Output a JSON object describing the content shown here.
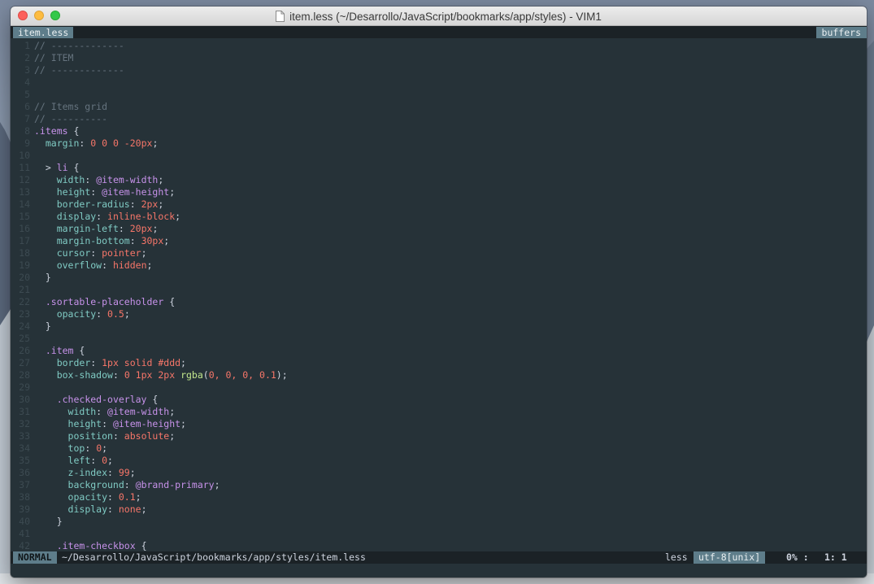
{
  "window": {
    "title": "item.less (~/Desarrollo/JavaScript/bookmarks/app/styles) - VIM1"
  },
  "tabline": {
    "active_tab": "item.less",
    "buffers_label": "buffers"
  },
  "editor": {
    "lines": [
      {
        "n": "1",
        "tokens": [
          {
            "t": "// -------------",
            "c": "com"
          }
        ]
      },
      {
        "n": "2",
        "tokens": [
          {
            "t": "// ITEM",
            "c": "com"
          }
        ]
      },
      {
        "n": "3",
        "tokens": [
          {
            "t": "// -------------",
            "c": "com"
          }
        ]
      },
      {
        "n": "4",
        "tokens": []
      },
      {
        "n": "5",
        "tokens": []
      },
      {
        "n": "6",
        "tokens": [
          {
            "t": "// Items grid",
            "c": "com"
          }
        ]
      },
      {
        "n": "7",
        "tokens": [
          {
            "t": "// ----------",
            "c": "com"
          }
        ]
      },
      {
        "n": "8",
        "tokens": [
          {
            "t": ".items",
            "c": "sel"
          },
          {
            "t": " {",
            "c": "pun"
          }
        ]
      },
      {
        "n": "9",
        "tokens": [
          {
            "t": "  ",
            "c": "pun"
          },
          {
            "t": "margin",
            "c": "prop"
          },
          {
            "t": ": ",
            "c": "pun"
          },
          {
            "t": "0 0 0 -20px",
            "c": "num"
          },
          {
            "t": ";",
            "c": "pun"
          }
        ]
      },
      {
        "n": "10",
        "tokens": []
      },
      {
        "n": "11",
        "tokens": [
          {
            "t": "  > ",
            "c": "pun"
          },
          {
            "t": "li",
            "c": "sel"
          },
          {
            "t": " {",
            "c": "pun"
          }
        ]
      },
      {
        "n": "12",
        "tokens": [
          {
            "t": "    ",
            "c": "pun"
          },
          {
            "t": "width",
            "c": "prop"
          },
          {
            "t": ": ",
            "c": "pun"
          },
          {
            "t": "@item-width",
            "c": "var"
          },
          {
            "t": ";",
            "c": "pun"
          }
        ]
      },
      {
        "n": "13",
        "tokens": [
          {
            "t": "    ",
            "c": "pun"
          },
          {
            "t": "height",
            "c": "prop"
          },
          {
            "t": ": ",
            "c": "pun"
          },
          {
            "t": "@item-height",
            "c": "var"
          },
          {
            "t": ";",
            "c": "pun"
          }
        ]
      },
      {
        "n": "14",
        "tokens": [
          {
            "t": "    ",
            "c": "pun"
          },
          {
            "t": "border-radius",
            "c": "prop"
          },
          {
            "t": ": ",
            "c": "pun"
          },
          {
            "t": "2px",
            "c": "num"
          },
          {
            "t": ";",
            "c": "pun"
          }
        ]
      },
      {
        "n": "15",
        "tokens": [
          {
            "t": "    ",
            "c": "pun"
          },
          {
            "t": "display",
            "c": "prop"
          },
          {
            "t": ": ",
            "c": "pun"
          },
          {
            "t": "inline-block",
            "c": "num"
          },
          {
            "t": ";",
            "c": "pun"
          }
        ]
      },
      {
        "n": "16",
        "tokens": [
          {
            "t": "    ",
            "c": "pun"
          },
          {
            "t": "margin-left",
            "c": "prop"
          },
          {
            "t": ": ",
            "c": "pun"
          },
          {
            "t": "20px",
            "c": "num"
          },
          {
            "t": ";",
            "c": "pun"
          }
        ]
      },
      {
        "n": "17",
        "tokens": [
          {
            "t": "    ",
            "c": "pun"
          },
          {
            "t": "margin-bottom",
            "c": "prop"
          },
          {
            "t": ": ",
            "c": "pun"
          },
          {
            "t": "30px",
            "c": "num"
          },
          {
            "t": ";",
            "c": "pun"
          }
        ]
      },
      {
        "n": "18",
        "tokens": [
          {
            "t": "    ",
            "c": "pun"
          },
          {
            "t": "cursor",
            "c": "prop"
          },
          {
            "t": ": ",
            "c": "pun"
          },
          {
            "t": "pointer",
            "c": "num"
          },
          {
            "t": ";",
            "c": "pun"
          }
        ]
      },
      {
        "n": "19",
        "tokens": [
          {
            "t": "    ",
            "c": "pun"
          },
          {
            "t": "overflow",
            "c": "prop"
          },
          {
            "t": ": ",
            "c": "pun"
          },
          {
            "t": "hidden",
            "c": "num"
          },
          {
            "t": ";",
            "c": "pun"
          }
        ]
      },
      {
        "n": "20",
        "tokens": [
          {
            "t": "  }",
            "c": "pun"
          }
        ]
      },
      {
        "n": "21",
        "tokens": []
      },
      {
        "n": "22",
        "tokens": [
          {
            "t": "  ",
            "c": "pun"
          },
          {
            "t": ".sortable-placeholder",
            "c": "sel"
          },
          {
            "t": " {",
            "c": "pun"
          }
        ]
      },
      {
        "n": "23",
        "tokens": [
          {
            "t": "    ",
            "c": "pun"
          },
          {
            "t": "opacity",
            "c": "prop"
          },
          {
            "t": ": ",
            "c": "pun"
          },
          {
            "t": "0.5",
            "c": "num"
          },
          {
            "t": ";",
            "c": "pun"
          }
        ]
      },
      {
        "n": "24",
        "tokens": [
          {
            "t": "  }",
            "c": "pun"
          }
        ]
      },
      {
        "n": "25",
        "tokens": []
      },
      {
        "n": "26",
        "tokens": [
          {
            "t": "  ",
            "c": "pun"
          },
          {
            "t": ".item",
            "c": "sel"
          },
          {
            "t": " {",
            "c": "pun"
          }
        ]
      },
      {
        "n": "27",
        "tokens": [
          {
            "t": "    ",
            "c": "pun"
          },
          {
            "t": "border",
            "c": "prop"
          },
          {
            "t": ": ",
            "c": "pun"
          },
          {
            "t": "1px solid #ddd",
            "c": "num"
          },
          {
            "t": ";",
            "c": "pun"
          }
        ]
      },
      {
        "n": "28",
        "tokens": [
          {
            "t": "    ",
            "c": "pun"
          },
          {
            "t": "box-shadow",
            "c": "prop"
          },
          {
            "t": ": ",
            "c": "pun"
          },
          {
            "t": "0 1px 2px ",
            "c": "num"
          },
          {
            "t": "rgba",
            "c": "fn"
          },
          {
            "t": "(",
            "c": "pun"
          },
          {
            "t": "0, 0, 0, 0.1",
            "c": "num"
          },
          {
            "t": ");",
            "c": "pun"
          }
        ]
      },
      {
        "n": "29",
        "tokens": []
      },
      {
        "n": "30",
        "tokens": [
          {
            "t": "    ",
            "c": "pun"
          },
          {
            "t": ".checked-overlay",
            "c": "sel"
          },
          {
            "t": " {",
            "c": "pun"
          }
        ]
      },
      {
        "n": "31",
        "tokens": [
          {
            "t": "      ",
            "c": "pun"
          },
          {
            "t": "width",
            "c": "prop"
          },
          {
            "t": ": ",
            "c": "pun"
          },
          {
            "t": "@item-width",
            "c": "var"
          },
          {
            "t": ";",
            "c": "pun"
          }
        ]
      },
      {
        "n": "32",
        "tokens": [
          {
            "t": "      ",
            "c": "pun"
          },
          {
            "t": "height",
            "c": "prop"
          },
          {
            "t": ": ",
            "c": "pun"
          },
          {
            "t": "@item-height",
            "c": "var"
          },
          {
            "t": ";",
            "c": "pun"
          }
        ]
      },
      {
        "n": "33",
        "tokens": [
          {
            "t": "      ",
            "c": "pun"
          },
          {
            "t": "position",
            "c": "prop"
          },
          {
            "t": ": ",
            "c": "pun"
          },
          {
            "t": "absolute",
            "c": "num"
          },
          {
            "t": ";",
            "c": "pun"
          }
        ]
      },
      {
        "n": "34",
        "tokens": [
          {
            "t": "      ",
            "c": "pun"
          },
          {
            "t": "top",
            "c": "prop"
          },
          {
            "t": ": ",
            "c": "pun"
          },
          {
            "t": "0",
            "c": "num"
          },
          {
            "t": ";",
            "c": "pun"
          }
        ]
      },
      {
        "n": "35",
        "tokens": [
          {
            "t": "      ",
            "c": "pun"
          },
          {
            "t": "left",
            "c": "prop"
          },
          {
            "t": ": ",
            "c": "pun"
          },
          {
            "t": "0",
            "c": "num"
          },
          {
            "t": ";",
            "c": "pun"
          }
        ]
      },
      {
        "n": "36",
        "tokens": [
          {
            "t": "      ",
            "c": "pun"
          },
          {
            "t": "z-index",
            "c": "prop"
          },
          {
            "t": ": ",
            "c": "pun"
          },
          {
            "t": "99",
            "c": "num"
          },
          {
            "t": ";",
            "c": "pun"
          }
        ]
      },
      {
        "n": "37",
        "tokens": [
          {
            "t": "      ",
            "c": "pun"
          },
          {
            "t": "background",
            "c": "prop"
          },
          {
            "t": ": ",
            "c": "pun"
          },
          {
            "t": "@brand-primary",
            "c": "var"
          },
          {
            "t": ";",
            "c": "pun"
          }
        ]
      },
      {
        "n": "38",
        "tokens": [
          {
            "t": "      ",
            "c": "pun"
          },
          {
            "t": "opacity",
            "c": "prop"
          },
          {
            "t": ": ",
            "c": "pun"
          },
          {
            "t": "0.1",
            "c": "num"
          },
          {
            "t": ";",
            "c": "pun"
          }
        ]
      },
      {
        "n": "39",
        "tokens": [
          {
            "t": "      ",
            "c": "pun"
          },
          {
            "t": "display",
            "c": "prop"
          },
          {
            "t": ": ",
            "c": "pun"
          },
          {
            "t": "none",
            "c": "num"
          },
          {
            "t": ";",
            "c": "pun"
          }
        ]
      },
      {
        "n": "40",
        "tokens": [
          {
            "t": "    }",
            "c": "pun"
          }
        ]
      },
      {
        "n": "41",
        "tokens": []
      },
      {
        "n": "42",
        "tokens": [
          {
            "t": "    ",
            "c": "pun"
          },
          {
            "t": ".item-checkbox",
            "c": "sel"
          },
          {
            "t": " {",
            "c": "pun"
          }
        ]
      }
    ]
  },
  "statusline": {
    "mode": "NORMAL",
    "filepath": "~/Desarrollo/JavaScript/bookmarks/app/styles/item.less",
    "filetype": "less",
    "encoding": "utf-8[unix]",
    "percent": "0% :",
    "position": "1:  1"
  },
  "colors": {
    "background": "#263238",
    "comment": "#65737e",
    "selector": "#c792ea",
    "property": "#80cbc4",
    "value": "#f77669",
    "function": "#c3e88d",
    "accent": "#5e7d8a"
  },
  "icons": {
    "title_icon": "document-icon"
  }
}
